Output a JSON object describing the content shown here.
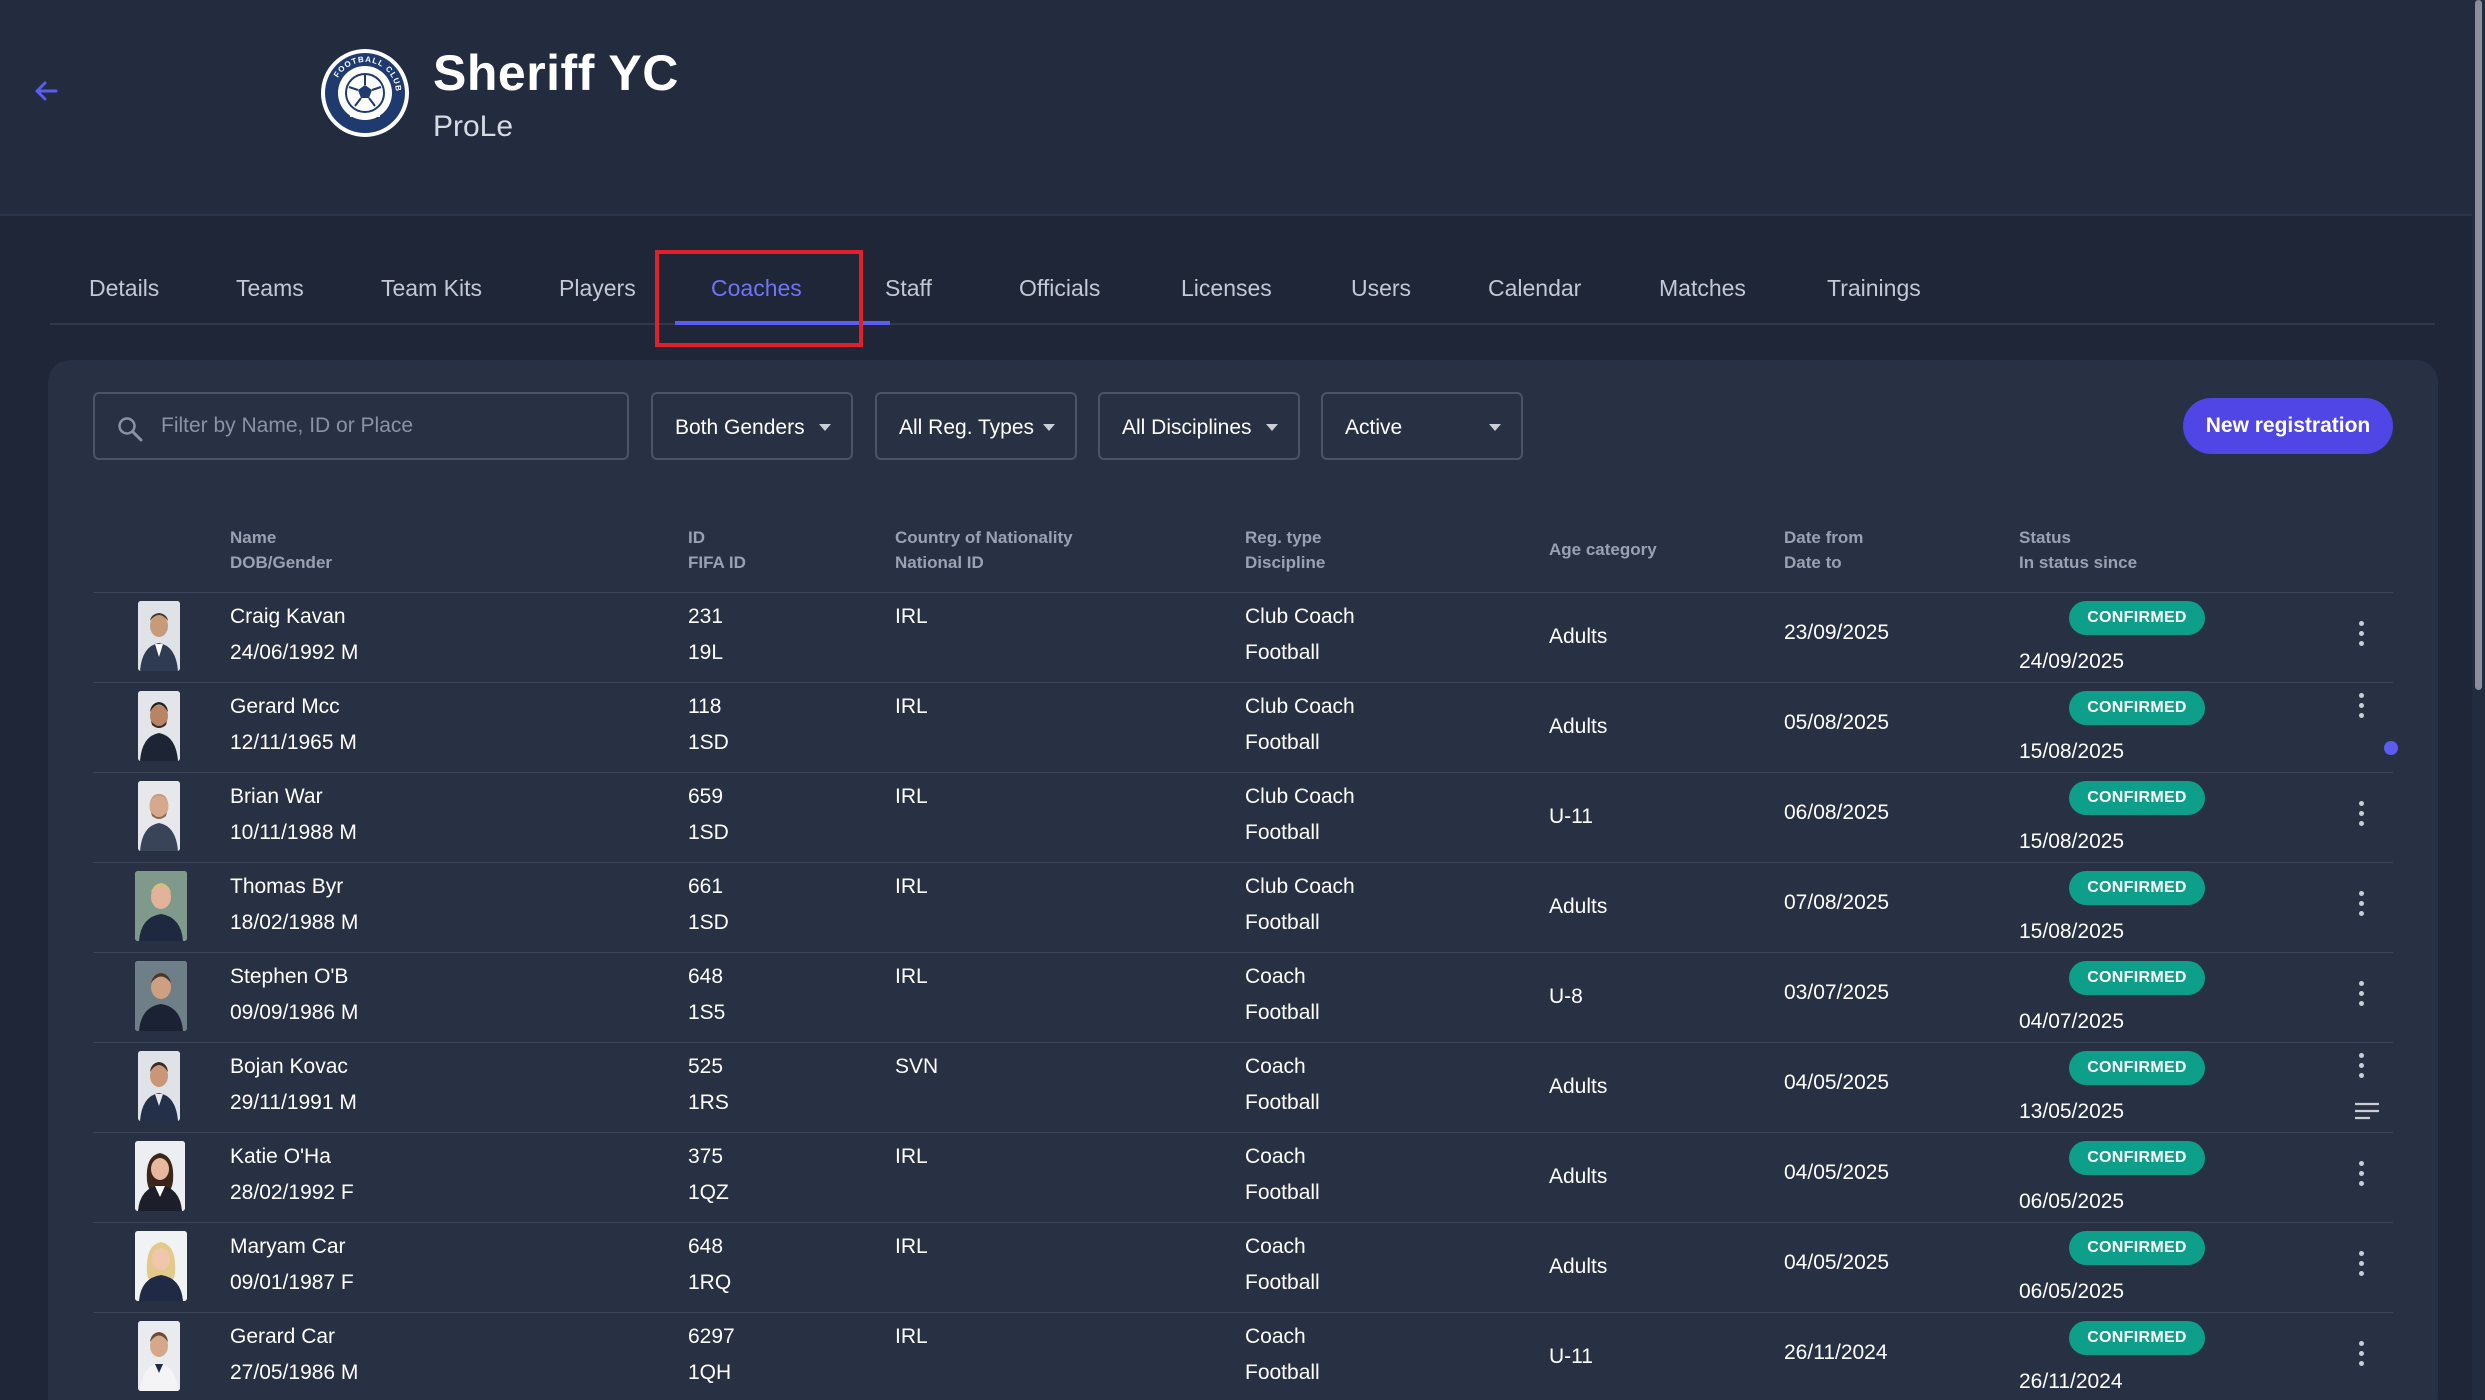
{
  "header": {
    "club_name": "Sheriff YC",
    "club_subtitle": "ProLe",
    "logo_text": "FOOTBALL CLUB"
  },
  "tabs": [
    {
      "label": "Details",
      "active": false
    },
    {
      "label": "Teams",
      "active": false
    },
    {
      "label": "Team Kits",
      "active": false
    },
    {
      "label": "Players",
      "active": false
    },
    {
      "label": "Coaches",
      "active": true
    },
    {
      "label": "Staff",
      "active": false
    },
    {
      "label": "Officials",
      "active": false
    },
    {
      "label": "Licenses",
      "active": false
    },
    {
      "label": "Users",
      "active": false
    },
    {
      "label": "Calendar",
      "active": false
    },
    {
      "label": "Matches",
      "active": false
    },
    {
      "label": "Trainings",
      "active": false
    }
  ],
  "filters": {
    "search_placeholder": "Filter by Name, ID or Place",
    "gender": "Both Genders",
    "reg_types": "All Reg. Types",
    "disciplines": "All Disciplines",
    "status": "Active",
    "new_registration": "New registration"
  },
  "table": {
    "headers": {
      "name": "Name",
      "dob_gender": "DOB/Gender",
      "id": "ID",
      "fifa_id": "FIFA ID",
      "country": "Country of Nationality",
      "national_id": "National ID",
      "reg_type": "Reg. type",
      "discipline": "Discipline",
      "age_category": "Age category",
      "date_from": "Date from",
      "date_to": "Date to",
      "status": "Status",
      "status_since": "In status since"
    },
    "rows": [
      {
        "name": "Craig Kavan",
        "dob": "24/06/1992 M",
        "id": "231",
        "fifa": "19L",
        "country": "IRL",
        "reg_type": "Club Coach",
        "discipline": "Football",
        "age": "Adults",
        "date_from": "23/09/2025",
        "status": "CONFIRMED",
        "since": "24/09/2025"
      },
      {
        "name": "Gerard Mcc",
        "dob": "12/11/1965 M",
        "id": "118",
        "fifa": "1SD",
        "country": "IRL",
        "reg_type": "Club Coach",
        "discipline": "Football",
        "age": "Adults",
        "date_from": "05/08/2025",
        "status": "CONFIRMED",
        "since": "15/08/2025"
      },
      {
        "name": "Brian War",
        "dob": "10/11/1988 M",
        "id": "659",
        "fifa": "1SD",
        "country": "IRL",
        "reg_type": "Club Coach",
        "discipline": "Football",
        "age": "U-11",
        "date_from": "06/08/2025",
        "status": "CONFIRMED",
        "since": "15/08/2025"
      },
      {
        "name": "Thomas Byr",
        "dob": "18/02/1988 M",
        "id": "661",
        "fifa": "1SD",
        "country": "IRL",
        "reg_type": "Club Coach",
        "discipline": "Football",
        "age": "Adults",
        "date_from": "07/08/2025",
        "status": "CONFIRMED",
        "since": "15/08/2025"
      },
      {
        "name": "Stephen O'B",
        "dob": "09/09/1986 M",
        "id": "648",
        "fifa": "1S5",
        "country": "IRL",
        "reg_type": "Coach",
        "discipline": "Football",
        "age": "U-8",
        "date_from": "03/07/2025",
        "status": "CONFIRMED",
        "since": "04/07/2025"
      },
      {
        "name": "Bojan Kovac",
        "dob": "29/11/1991 M",
        "id": "525",
        "fifa": "1RS",
        "country": "SVN",
        "reg_type": "Coach",
        "discipline": "Football",
        "age": "Adults",
        "date_from": "04/05/2025",
        "status": "CONFIRMED",
        "since": "13/05/2025"
      },
      {
        "name": "Katie O'Ha",
        "dob": "28/02/1992 F",
        "id": "375",
        "fifa": "1QZ",
        "country": "IRL",
        "reg_type": "Coach",
        "discipline": "Football",
        "age": "Adults",
        "date_from": "04/05/2025",
        "status": "CONFIRMED",
        "since": "06/05/2025"
      },
      {
        "name": "Maryam Car",
        "dob": "09/01/1987 F",
        "id": "648",
        "fifa": "1RQ",
        "country": "IRL",
        "reg_type": "Coach",
        "discipline": "Football",
        "age": "Adults",
        "date_from": "04/05/2025",
        "status": "CONFIRMED",
        "since": "06/05/2025"
      },
      {
        "name": "Gerard Car",
        "dob": "27/05/1986 M",
        "id": "6297",
        "fifa": "1QH",
        "country": "IRL",
        "reg_type": "Coach",
        "discipline": "Football",
        "age": "U-11",
        "date_from": "26/11/2024",
        "status": "CONFIRMED",
        "since": "26/11/2024"
      }
    ]
  },
  "colors": {
    "accent": "#5b5cf0",
    "button": "#4f46e5",
    "status_confirmed": "#0e9f8b",
    "background": "#1f2638",
    "panel": "#283043"
  }
}
